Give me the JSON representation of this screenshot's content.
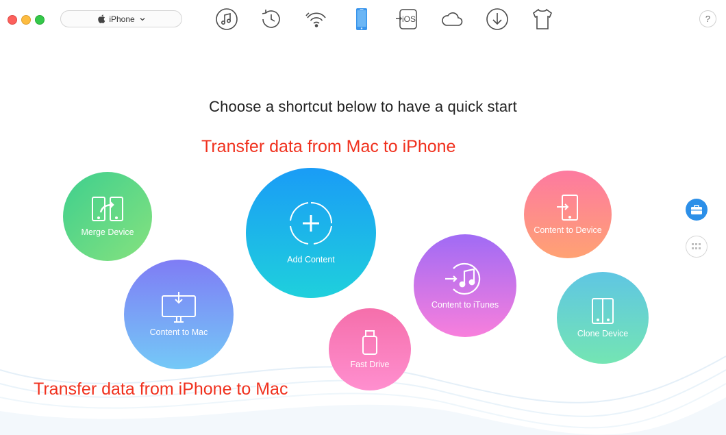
{
  "window": {
    "device_selector": {
      "label": "iPhone",
      "icon": "apple-logo-icon"
    }
  },
  "toolbar": {
    "icons": [
      {
        "name": "music-icon",
        "active": false
      },
      {
        "name": "history-icon",
        "active": false
      },
      {
        "name": "wifi-sync-icon",
        "active": false
      },
      {
        "name": "iphone-icon",
        "active": true
      },
      {
        "name": "ios-mover-icon",
        "label": "iOS",
        "active": false
      },
      {
        "name": "icloud-icon",
        "active": false
      },
      {
        "name": "download-icon",
        "active": false
      },
      {
        "name": "tshirt-icon",
        "active": false
      }
    ],
    "help_label": "?"
  },
  "main": {
    "heading": "Choose a shortcut below to have a quick start",
    "annotation_top": "Transfer data from Mac to iPhone",
    "annotation_bottom": "Transfer data from iPhone to Mac"
  },
  "shortcuts": {
    "merge_device": "Merge Device",
    "content_to_mac": "Content to Mac",
    "add_content": "Add Content",
    "fast_drive": "Fast Drive",
    "content_to_itunes": "Content to iTunes",
    "content_to_device": "Content to Device",
    "clone_device": "Clone Device"
  },
  "sidebar": {
    "buttons": [
      {
        "name": "toolbox-icon",
        "active": true
      },
      {
        "name": "grid-icon",
        "active": false
      }
    ]
  },
  "colors": {
    "accent": "#2c8fe8",
    "annotation": "#f0311e",
    "merge": "#3ecf8e",
    "content_to_mac": "#7f7cf5",
    "add_content": "#1a9cf6",
    "fast_drive": "#f56fab",
    "content_to_itunes": "#a06bf5",
    "content_to_device": "#fd7aa0",
    "clone_device": "#5fc6e3"
  }
}
